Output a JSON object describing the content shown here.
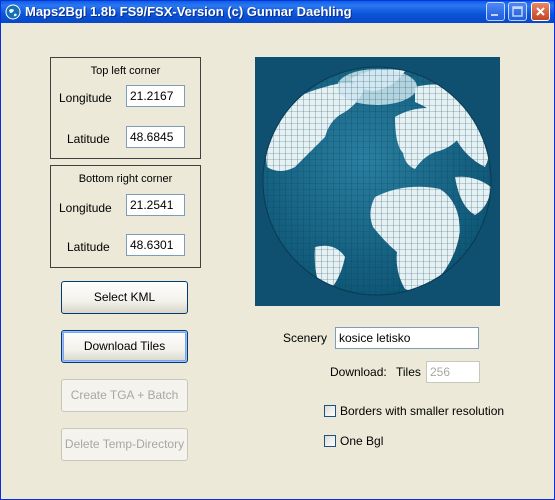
{
  "window": {
    "title": "Maps2Bgl 1.8b FS9/FSX-Version (c) Gunnar Daehling"
  },
  "top_left": {
    "title": "Top left corner",
    "longitude_label": "Longitude",
    "longitude_value": "21.2167",
    "latitude_label": "Latitude",
    "latitude_value": "48.6845"
  },
  "bottom_right": {
    "title": "Bottom right corner",
    "longitude_label": "Longitude",
    "longitude_value": "21.2541",
    "latitude_label": "Latitude",
    "latitude_value": "48.6301"
  },
  "buttons": {
    "select_kml": "Select KML",
    "download_tiles": "Download Tiles",
    "create_tga": "Create TGA + Batch",
    "delete_temp": "Delete Temp-Directory"
  },
  "scenery": {
    "label": "Scenery",
    "value": "kosice letisko"
  },
  "download": {
    "label": "Download:",
    "tiles_label": "Tiles",
    "tiles_value": "256"
  },
  "options": {
    "borders_label": "Borders with smaller resolution",
    "borders_checked": false,
    "one_bgl_label": "One Bgl",
    "one_bgl_checked": false
  },
  "colors": {
    "ocean": "#0f5a78",
    "land": "#e6f1f4",
    "background": "#0f4f6f"
  },
  "icons": [
    "globe-app-icon",
    "minimize-icon",
    "maximize-icon",
    "close-icon"
  ]
}
